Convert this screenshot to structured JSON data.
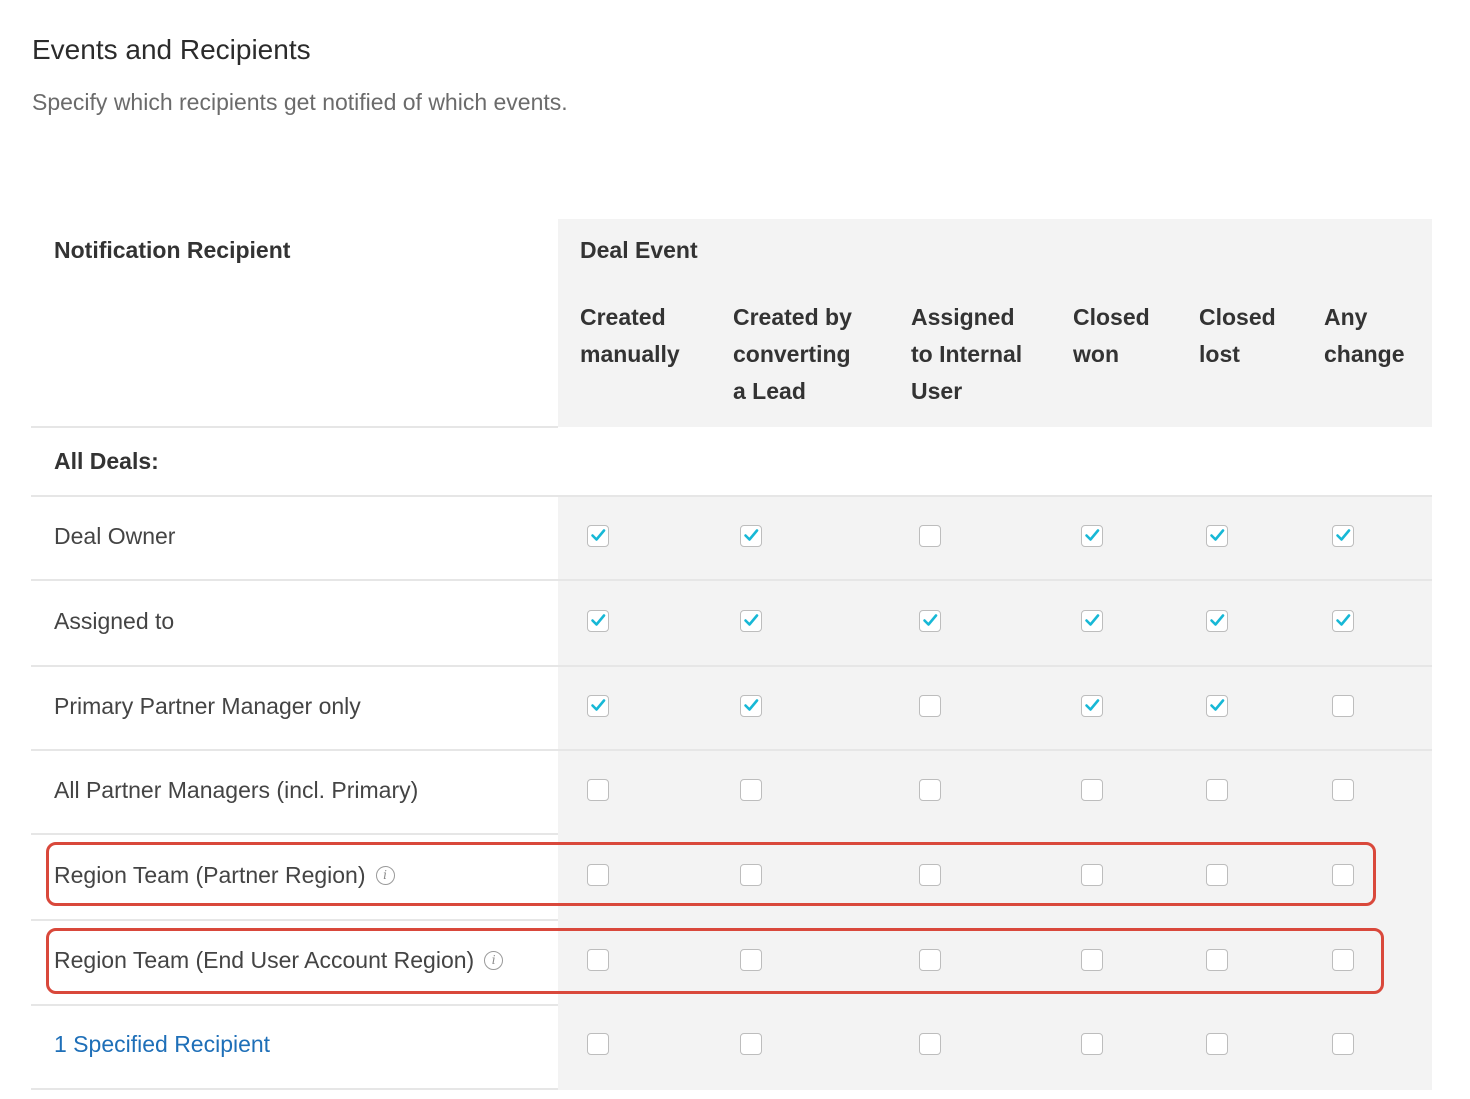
{
  "header": {
    "title": "Events and Recipients",
    "subtitle": "Specify which recipients get notified of which events."
  },
  "table": {
    "recipient_header": "Notification Recipient",
    "event_group_header": "Deal Event",
    "columns": [
      "Created\nmanually",
      "Created by\nconverting\na Lead",
      "Assigned\nto Internal\nUser",
      "Closed\nwon",
      "Closed\nlost",
      "Any\nchange"
    ],
    "section_label": "All Deals:",
    "rows": [
      {
        "label": "Deal Owner",
        "checks": [
          true,
          true,
          false,
          true,
          true,
          true
        ]
      },
      {
        "label": "Assigned to",
        "checks": [
          true,
          true,
          true,
          true,
          true,
          true
        ]
      },
      {
        "label": "Primary Partner Manager only",
        "checks": [
          true,
          true,
          false,
          true,
          true,
          false
        ]
      },
      {
        "label": "All Partner Managers (incl. Primary)",
        "checks": [
          false,
          false,
          false,
          false,
          false,
          false
        ]
      },
      {
        "label": "Region Team (Partner Region)",
        "checks": [
          false,
          false,
          false,
          false,
          false,
          false
        ],
        "info_icon": "info-icon",
        "highlighted": true
      },
      {
        "label": "Region Team (End User Account Region)",
        "checks": [
          false,
          false,
          false,
          false,
          false,
          false
        ],
        "info_icon": "info-icon",
        "highlighted": true
      },
      {
        "label": "1 Specified Recipient",
        "checks": [
          false,
          false,
          false,
          false,
          false,
          false
        ],
        "link": true
      }
    ]
  },
  "colors": {
    "check": "#17b8d6",
    "highlight": "#d9483b",
    "link": "#1e6fb8",
    "event_bg": "#f3f3f3"
  }
}
